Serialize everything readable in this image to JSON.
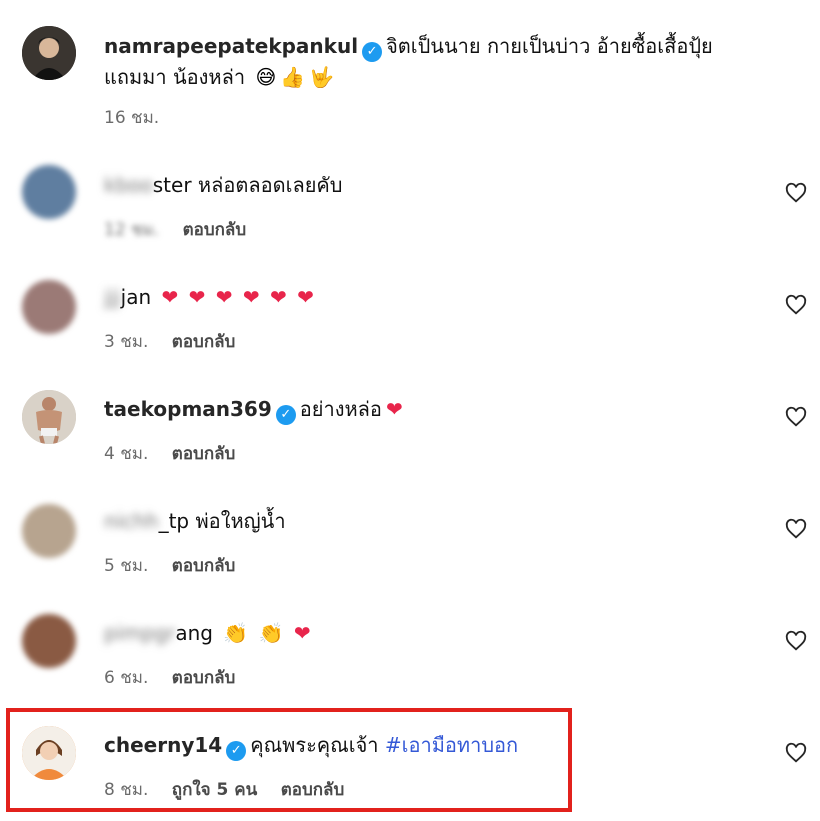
{
  "comments": [
    {
      "username": "namrapeepatekpankul",
      "verified": true,
      "text_line1": "จิตเป็นนาย กายเป็นบ่าว อ้ายซื้อเสื้อปุ้ย",
      "text_line2": "แถมมา น้องหล่า",
      "emojis": [
        "😅",
        "👍",
        "🤟"
      ],
      "time": "16 ชม.",
      "avatar_color": "#2a2a2a"
    },
    {
      "username": "kbooster",
      "username_visible_part": "ster",
      "text": "หล่อตลอดเลยคับ",
      "time": "12 ชม.",
      "reply_label": "ตอบกลับ",
      "avatar_color": "#5f7ea0"
    },
    {
      "username": "jjjjan",
      "username_visible_part": "jan",
      "hearts": [
        "❤",
        "❤",
        "❤",
        "❤",
        "❤",
        "❤"
      ],
      "time": "3 ชม.",
      "reply_label": "ตอบกลับ",
      "avatar_color": "#9b7a76"
    },
    {
      "username": "taekopman369",
      "verified": true,
      "text": "อย่างหล่อ",
      "emojis": [
        "❤"
      ],
      "time": "4 ชม.",
      "reply_label": "ตอบกลับ",
      "avatar_color": "#c9bfb3"
    },
    {
      "username": "nichh_tp",
      "username_visible_part": "_tp",
      "text": "พ่อใหญ่น้ำ",
      "time": "5 ชม.",
      "reply_label": "ตอบกลับ",
      "avatar_color": "#b7a48f"
    },
    {
      "username": "pimpgrang",
      "username_visible_part": "ang",
      "emojis": [
        "👏",
        "👏",
        "❤"
      ],
      "time": "6 ชม.",
      "reply_label": "ตอบกลับ",
      "avatar_color": "#8a5a43"
    },
    {
      "username": "cheerny14",
      "verified": true,
      "text": "คุณพระคุณเจ้า",
      "hashtag": "#เอามือทาบอก",
      "time": "8 ชม.",
      "likes": "ถูกใจ 5 คน",
      "reply_label": "ตอบกลับ",
      "avatar_color": "#e8873a",
      "highlighted": true
    }
  ],
  "icons": {
    "like": "heart-outline-icon",
    "verified": "verified-badge-icon"
  },
  "colors": {
    "highlight": "#e2211c",
    "hashtag": "#3559d6",
    "verified": "#1d9bf0"
  }
}
